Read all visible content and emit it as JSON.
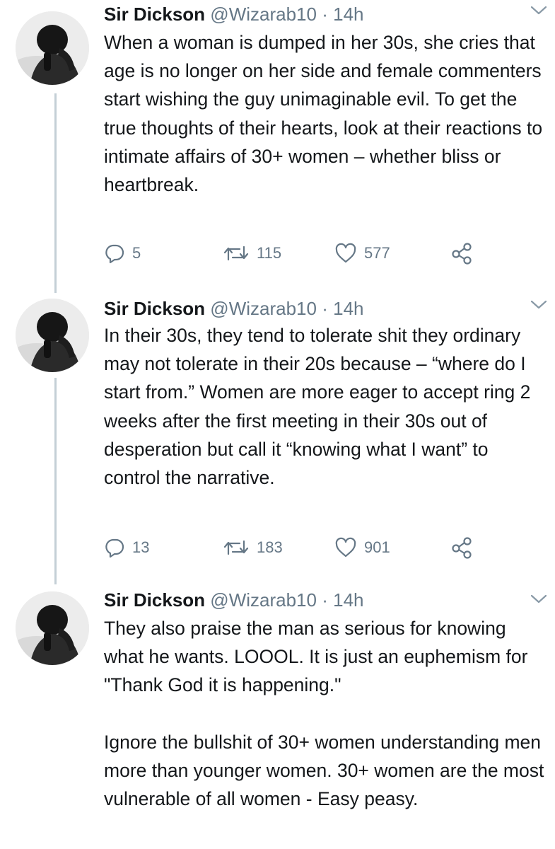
{
  "colors": {
    "text": "#14171a",
    "muted": "#657786",
    "thread_line": "#c4cfd6",
    "icon": "#657786"
  },
  "tweets": [
    {
      "name": "Sir Dickson",
      "handle": "@Wizarab10",
      "separator": "·",
      "time": "14h",
      "paragraphs": [
        "When a woman is dumped in her 30s, she cries that age is no longer on her side and female commenters start wishing the guy unimaginable evil. To get the true thoughts of their hearts, look at their reactions to intimate affairs of 30+ women – whether bliss or heartbreak."
      ],
      "replies": "5",
      "retweets": "115",
      "likes": "577",
      "icons": [
        "reply-icon",
        "retweet-icon",
        "like-icon",
        "share-icon",
        "chevron-down-icon"
      ]
    },
    {
      "name": "Sir Dickson",
      "handle": "@Wizarab10",
      "separator": "·",
      "time": "14h",
      "paragraphs": [
        "In their 30s, they tend to tolerate shit they ordinary may not tolerate in their 20s because – “where do I start from.” Women are more eager to accept ring 2 weeks after the first meeting in their 30s out of desperation but call it “knowing what I want” to control the narrative."
      ],
      "replies": "13",
      "retweets": "183",
      "likes": "901",
      "icons": [
        "reply-icon",
        "retweet-icon",
        "like-icon",
        "share-icon",
        "chevron-down-icon"
      ]
    },
    {
      "name": "Sir Dickson",
      "handle": "@Wizarab10",
      "separator": "·",
      "time": "14h",
      "paragraphs": [
        "They also praise the man as serious for knowing what he wants. LOOOL. It is just an euphemism for \"Thank God it is happening.\"",
        "Ignore the bullshit of 30+ women understanding men more than younger women. 30+ women are the most vulnerable of all women - Easy peasy."
      ],
      "icons": [
        "chevron-down-icon"
      ]
    }
  ]
}
